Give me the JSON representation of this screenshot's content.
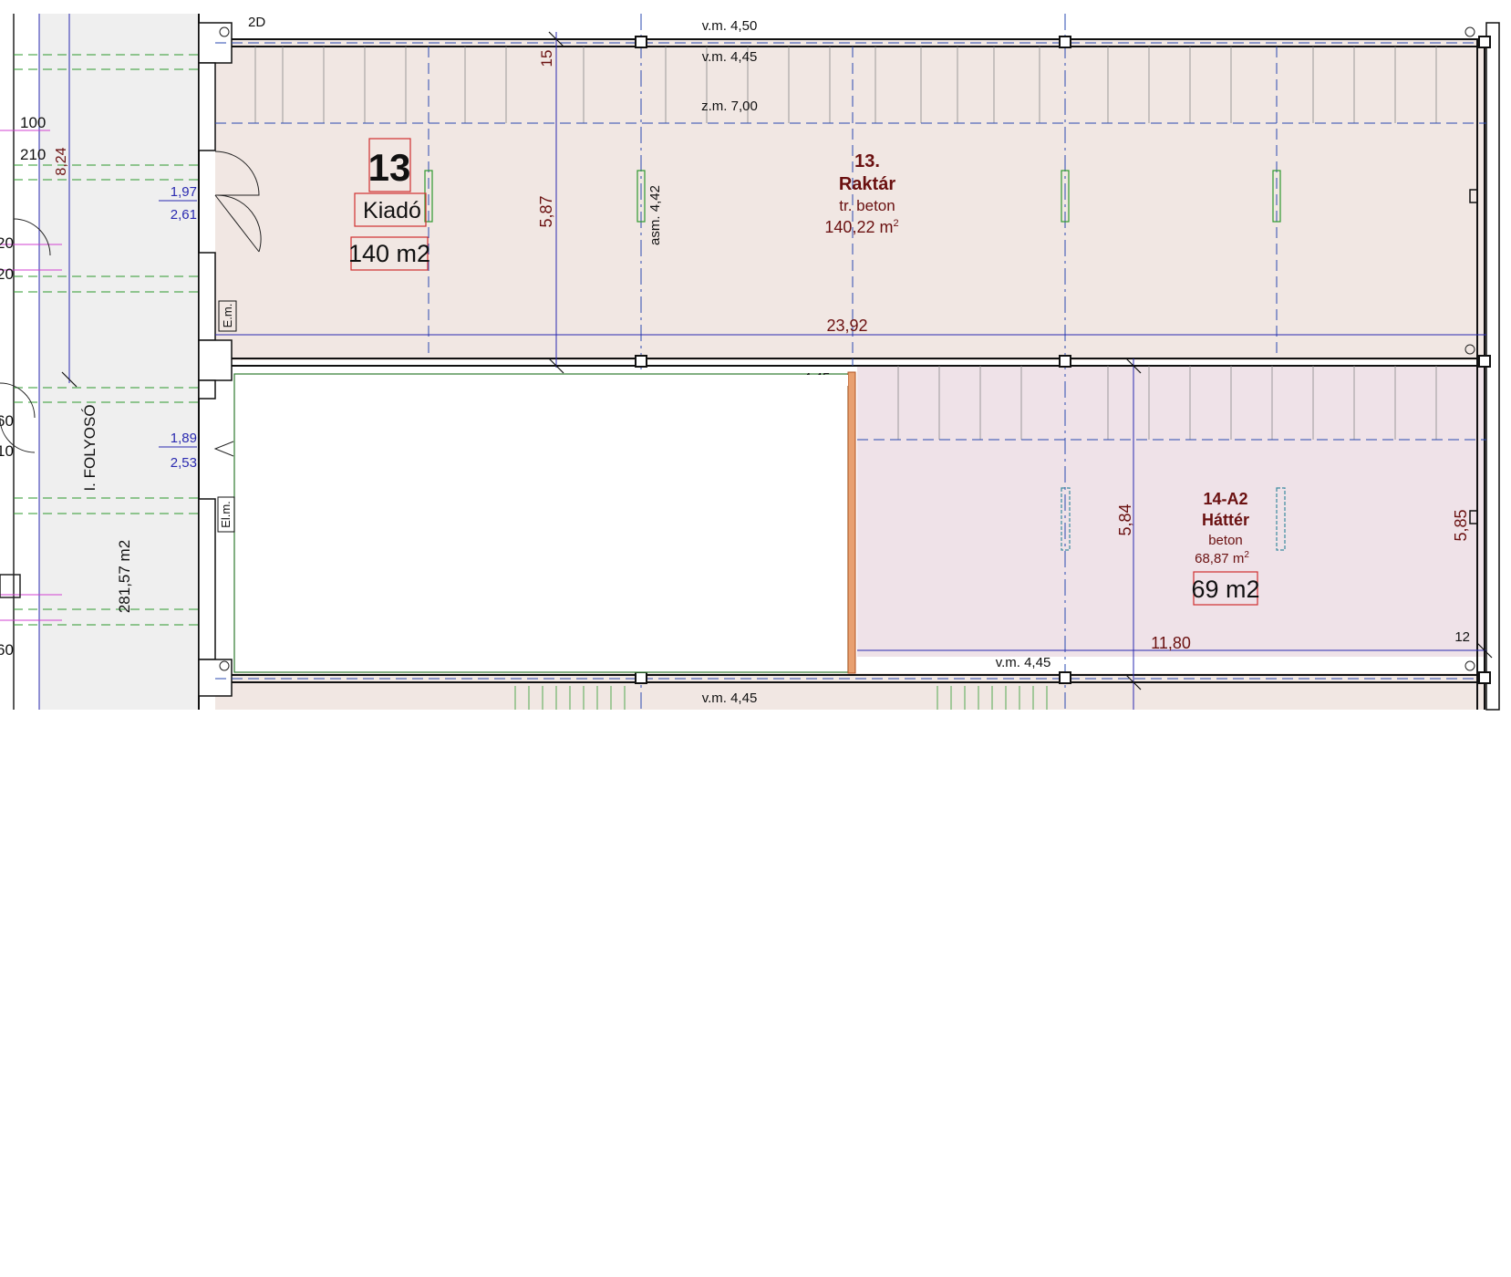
{
  "plan": {
    "corridor": {
      "name": "I. FOLYOSÓ",
      "area": "281,57 m2",
      "dim_height": "8,24",
      "dim_a": "100",
      "dim_b": "210"
    },
    "left_labels": {
      "l1": "20",
      "l2": "20",
      "l3": "60",
      "l4": "10",
      "l5": "60"
    },
    "door_top": {
      "upper": "1,97",
      "lower": "2,61"
    },
    "door_bottom": {
      "upper": "1,89",
      "lower": "2,53"
    },
    "label_2d": "2D",
    "room13": {
      "badge_number": "13",
      "badge_status": "Kiadó",
      "badge_area": "140 m2",
      "number": "13.",
      "name": "Raktár",
      "floor": "tr. beton",
      "area_value": "140,22 m",
      "area_sup": "2",
      "width": "23,92",
      "height": "5,87",
      "height_small": "15",
      "asm": "asm. 4,42",
      "vm_top": "v.m. 4,50",
      "vm_second": "v.m. 4,45",
      "zm": "z.m. 7,00",
      "em": "E.m."
    },
    "room14": {
      "number": "14-A2",
      "name": "Háttér",
      "floor": "beton",
      "area_value": "68,87 m",
      "area_sup": "2",
      "badge_area": "69 m2",
      "width": "11,80",
      "height_left": "5,84",
      "height_right": "5,85",
      "small_right": "12",
      "vm_bottom": "v.m. 4,45",
      "vm_top_partial": "v.m. 4,45"
    },
    "elm_label": "El.m.",
    "bottom_vm": "v.m. 4,45"
  }
}
